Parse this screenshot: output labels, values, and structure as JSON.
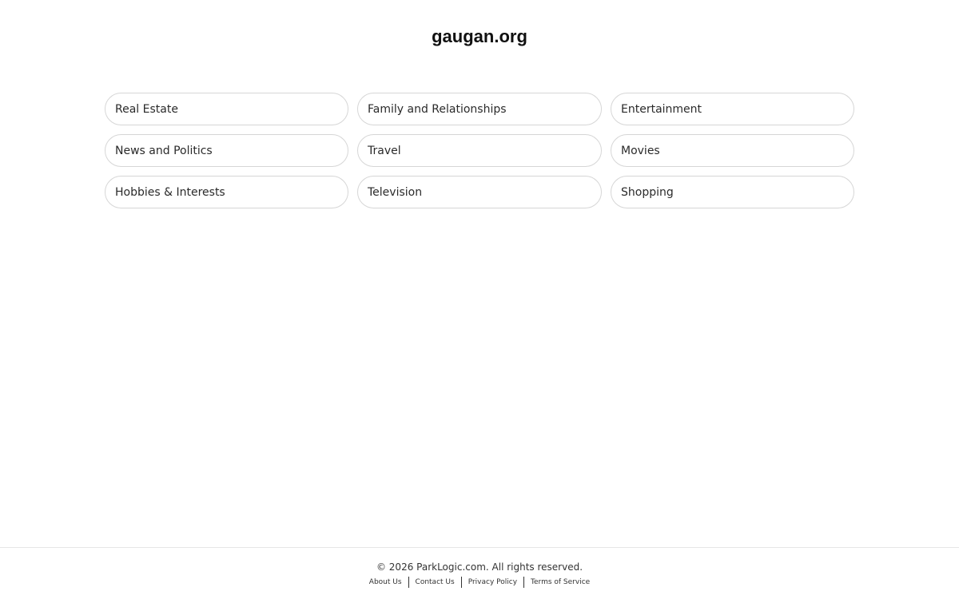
{
  "header": {
    "site_title": "gaugan.org"
  },
  "categories": [
    {
      "label": "Real Estate"
    },
    {
      "label": "Family and Relationships"
    },
    {
      "label": "Entertainment"
    },
    {
      "label": "News and Politics"
    },
    {
      "label": "Travel"
    },
    {
      "label": "Movies"
    },
    {
      "label": "Hobbies & Interests"
    },
    {
      "label": "Television"
    },
    {
      "label": "Shopping"
    }
  ],
  "footer": {
    "copyright": "© 2026 ParkLogic.com. All rights reserved.",
    "links": [
      {
        "label": "About Us"
      },
      {
        "label": "Contact Us"
      },
      {
        "label": "Privacy Policy"
      },
      {
        "label": "Terms of Service"
      }
    ]
  },
  "colors": {
    "background": "#ffffff",
    "pill_border": "#d6d6d6",
    "text": "#222222"
  }
}
